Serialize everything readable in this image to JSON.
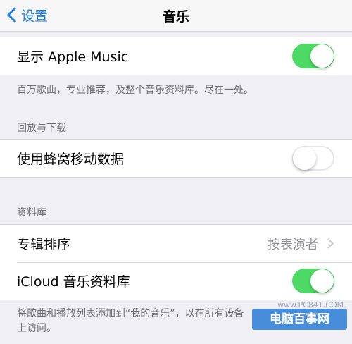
{
  "navbar": {
    "back_label": "设置",
    "title": "音乐"
  },
  "apple_music": {
    "label": "显示 Apple Music",
    "toggle_on": true,
    "note": "百万歌曲，专业推荐，及整个音乐资料库。尽在一处。"
  },
  "playback": {
    "header": "回放与下载",
    "cellular_label": "使用蜂窝移动数据",
    "cellular_on": false
  },
  "library": {
    "header": "资料库",
    "sort_label": "专辑排序",
    "sort_value": "按表演者",
    "icloud_label": "iCloud 音乐资料库",
    "icloud_on": true,
    "note": "将歌曲和播放列表添加到“我的音乐”，以在所有设备上访问。"
  },
  "watermark": {
    "url": "www.PC841.COM",
    "name": "电脑百事网"
  },
  "colors": {
    "accent": "#1a7cf6",
    "toggle_on": "#4cd964",
    "background": "#efeff4"
  }
}
